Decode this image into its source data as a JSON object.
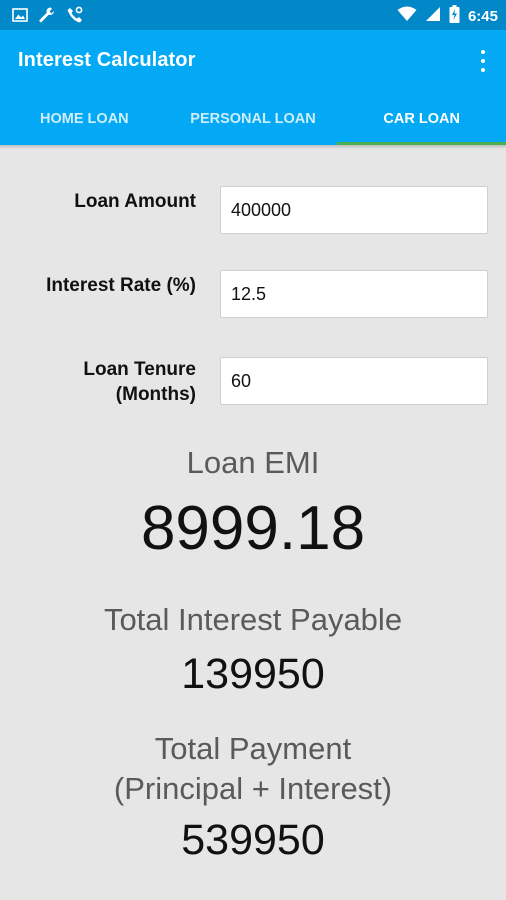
{
  "status_bar": {
    "time": "6:45"
  },
  "app_bar": {
    "title": "Interest Calculator"
  },
  "tabs": [
    {
      "label": "HOME LOAN",
      "active": false
    },
    {
      "label": "PERSONAL LOAN",
      "active": false
    },
    {
      "label": "CAR LOAN",
      "active": true
    }
  ],
  "form": {
    "loan_amount": {
      "label": "Loan Amount",
      "value": "400000"
    },
    "interest_rate": {
      "label": "Interest Rate (%)",
      "value": "12.5"
    },
    "loan_tenure": {
      "label_line1": "Loan Tenure",
      "label_line2": "(Months)",
      "value": "60"
    }
  },
  "results": {
    "emi_label": "Loan EMI",
    "emi_value": "8999.18",
    "total_interest_label": "Total Interest Payable",
    "total_interest_value": "139950",
    "total_payment_label_line1": "Total Payment",
    "total_payment_label_line2": "(Principal + Interest)",
    "total_payment_value": "539950"
  },
  "colors": {
    "status_bar": "#0288c9",
    "app_bar": "#03a9f4",
    "tab_indicator": "#4caf50",
    "background": "#e6e6e6"
  },
  "icons": [
    "image-icon",
    "wrench-icon",
    "phone-settings-icon",
    "wifi-icon",
    "signal-icon",
    "battery-icon",
    "overflow-menu-icon"
  ]
}
